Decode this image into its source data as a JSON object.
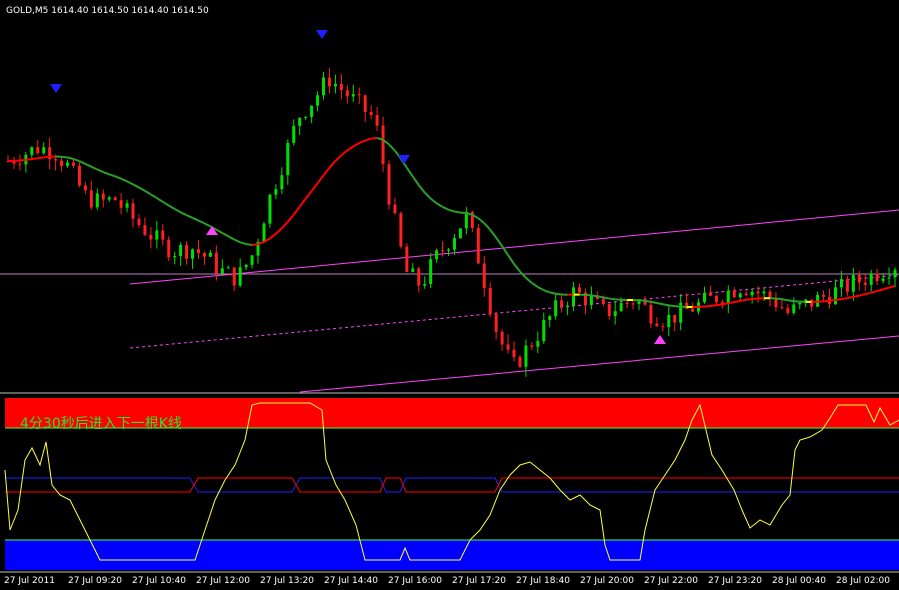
{
  "window": {
    "symbol": "GOLD,M5",
    "ohlc": [
      "1614.40",
      "1614.50",
      "1614.40",
      "1614.50"
    ]
  },
  "indicator": {
    "timer_text": "4分30秒后进入下一根K线"
  },
  "time_axis": {
    "ticks": [
      "27 Jul 2011",
      "27 Jul 09:20",
      "27 Jul 10:40",
      "27 Jul 12:00",
      "27 Jul 13:20",
      "27 Jul 14:40",
      "27 Jul 16:00",
      "27 Jul 17:20",
      "27 Jul 18:40",
      "27 Jul 20:00",
      "27 Jul 22:00",
      "27 Jul 23:20",
      "28 Jul 00:40",
      "28 Jul 02:00"
    ]
  },
  "colors": {
    "background": "#000000",
    "bull_candle": "#00e000",
    "bear_candle": "#ff2020",
    "ma_up": "#2aa02a",
    "ma_down": "#ff0000",
    "ma_flat": "#ffff00",
    "channel": "#ff44ff",
    "oscillator": "#ffff40",
    "overbought_zone": "#ff0000",
    "oversold_zone": "#0000ff",
    "signal_up": "#ff40ff",
    "signal_down": "#2020ff"
  },
  "chart_data": {
    "type": "candlestick",
    "series": [
      {
        "name": "GOLD,M5",
        "note": "close path (relative)",
        "values": [
          0.62,
          0.64,
          0.66,
          0.65,
          0.6,
          0.52,
          0.5,
          0.51,
          0.46,
          0.42,
          0.38,
          0.36,
          0.37,
          0.34,
          0.3,
          0.28,
          0.35,
          0.5,
          0.62,
          0.75,
          0.8,
          0.86,
          0.82,
          0.78,
          0.74,
          0.5,
          0.3,
          0.26,
          0.34,
          0.4,
          0.46,
          0.3,
          0.12,
          0.02,
          0.08,
          0.14,
          0.2,
          0.24,
          0.22,
          0.18,
          0.2,
          0.22,
          0.18,
          0.16,
          0.18,
          0.2,
          0.22,
          0.24,
          0.26,
          0.24,
          0.22,
          0.18,
          0.2,
          0.22,
          0.24,
          0.26,
          0.28,
          0.3,
          0.32
        ]
      }
    ]
  }
}
